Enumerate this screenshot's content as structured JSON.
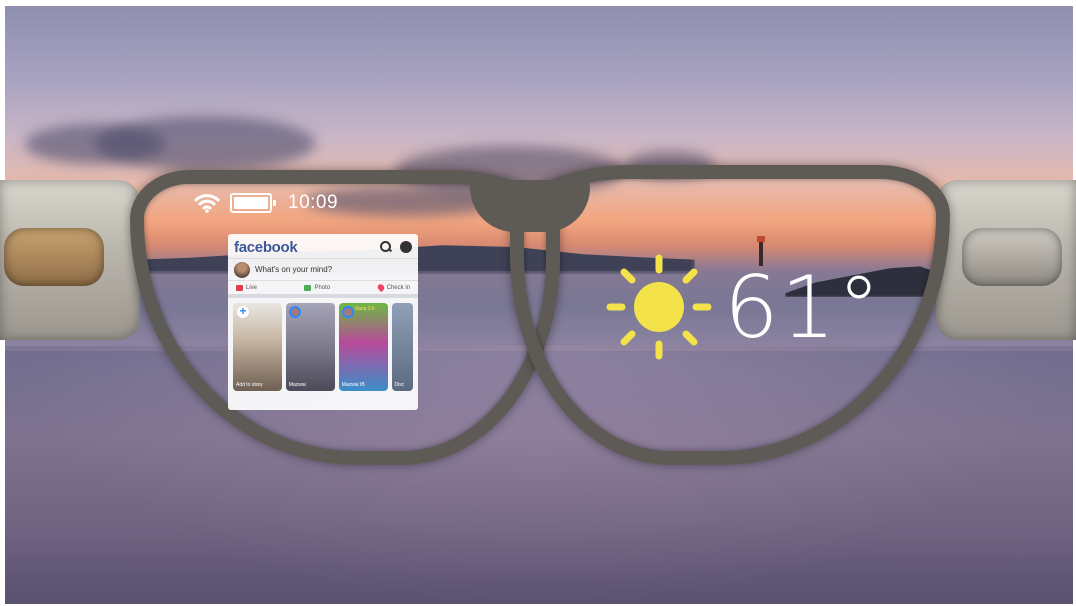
{
  "hud": {
    "time": "10:09",
    "icons": [
      "wifi-icon",
      "battery-icon"
    ]
  },
  "facebook": {
    "logo": "facebook",
    "compose_prompt": "What's on your mind?",
    "actions": [
      {
        "label": "Live",
        "icon": "live-icon"
      },
      {
        "label": "Photo",
        "icon": "photo-icon"
      },
      {
        "label": "Check in",
        "icon": "checkin-icon"
      }
    ],
    "stories": [
      {
        "label": "Add to story",
        "title": ""
      },
      {
        "label": "Mazwai",
        "title": ""
      },
      {
        "label": "Mazwai IB",
        "title": "Xana 3.h"
      },
      {
        "label": "Disc",
        "title": ""
      }
    ],
    "accent_color": "#3b5998"
  },
  "weather": {
    "temperature": "61°",
    "icon": "sun-icon",
    "sun_color": "#f3e24a"
  }
}
